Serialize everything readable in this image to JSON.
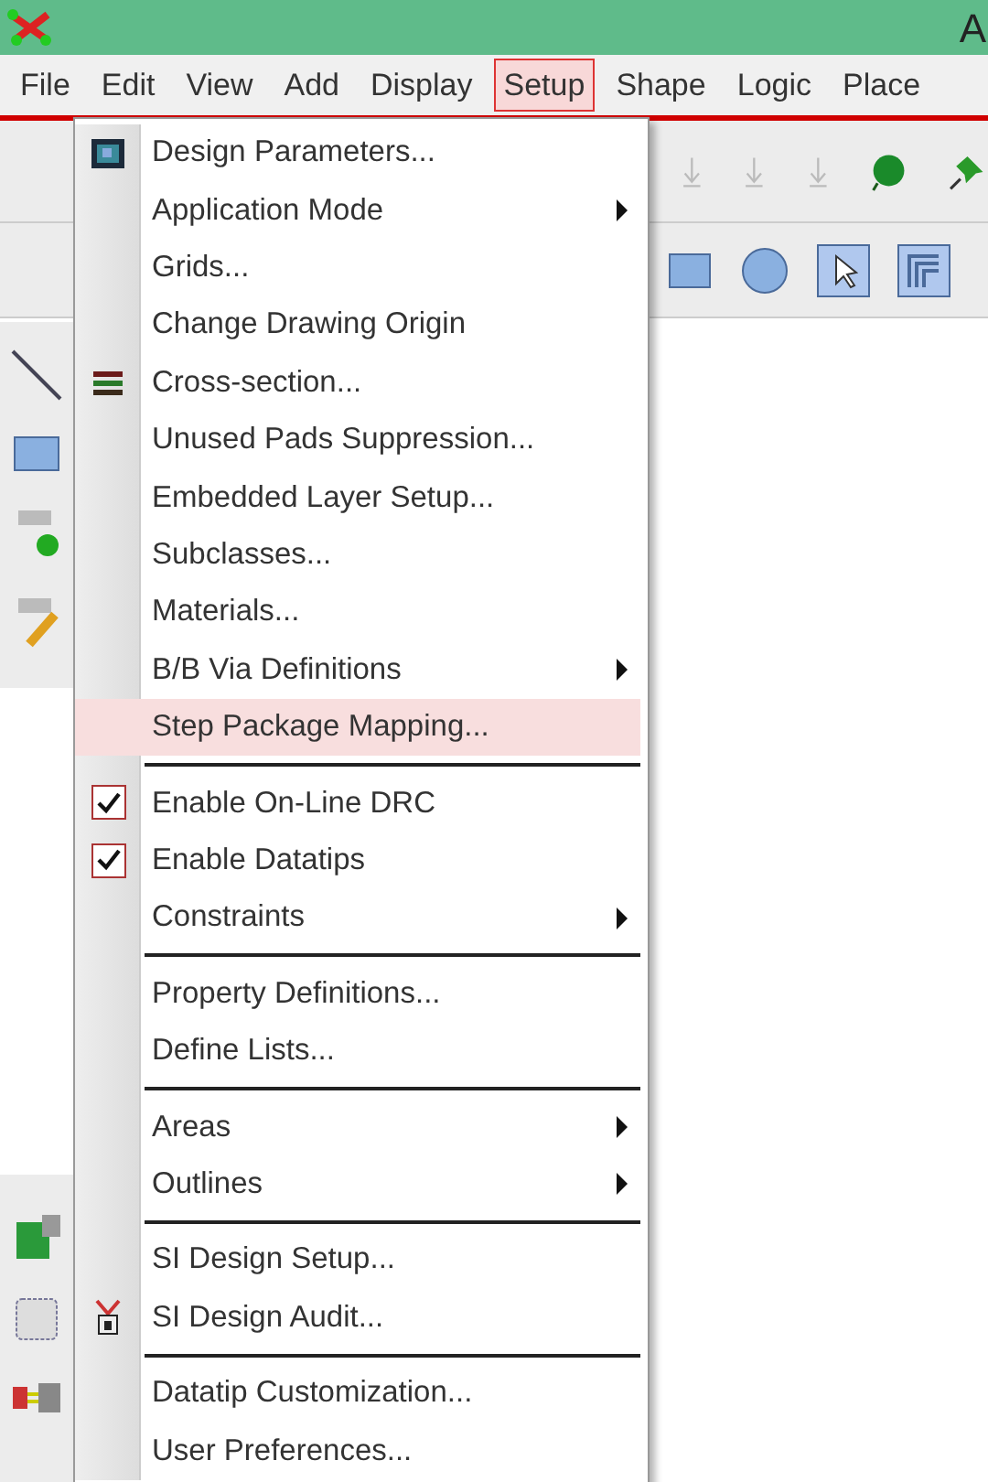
{
  "window": {
    "title": "A"
  },
  "menu_bar": [
    {
      "label": "File",
      "selected": false
    },
    {
      "label": "Edit",
      "selected": false
    },
    {
      "label": "View",
      "selected": false
    },
    {
      "label": "Add",
      "selected": false
    },
    {
      "label": "Display",
      "selected": false
    },
    {
      "label": "Setup",
      "selected": true
    },
    {
      "label": "Shape",
      "selected": false
    },
    {
      "label": "Logic",
      "selected": false
    },
    {
      "label": "Place",
      "selected": false
    }
  ],
  "menu": [
    {
      "kind": "command",
      "label": "Design Parameters...",
      "selected": false
    },
    {
      "kind": "submenu",
      "label": "Application Mode",
      "selected": false
    },
    {
      "kind": "command",
      "label": "Grids...",
      "selected": false
    },
    {
      "kind": "command",
      "label": "Change Drawing Origin",
      "selected": false
    },
    {
      "kind": "command",
      "label": "Cross-section...",
      "selected": false
    },
    {
      "kind": "command",
      "label": "Unused Pads Suppression...",
      "selected": false
    },
    {
      "kind": "command",
      "label": "Embedded Layer Setup...",
      "selected": false
    },
    {
      "kind": "command",
      "label": "Subclasses...",
      "selected": false
    },
    {
      "kind": "command",
      "label": "Materials...",
      "selected": false
    },
    {
      "kind": "submenu",
      "label": "B/B Via Definitions",
      "selected": false
    },
    {
      "kind": "command",
      "label": "Step Package Mapping...",
      "selected": true
    },
    {
      "kind": "separator"
    },
    {
      "kind": "check",
      "label": "Enable On-Line DRC",
      "checked": true,
      "selected": false
    },
    {
      "kind": "check",
      "label": "Enable Datatips",
      "checked": true,
      "selected": false
    },
    {
      "kind": "submenu",
      "label": "Constraints",
      "selected": false
    },
    {
      "kind": "separator"
    },
    {
      "kind": "command",
      "label": "Property Definitions...",
      "selected": false
    },
    {
      "kind": "command",
      "label": "Define Lists...",
      "selected": false
    },
    {
      "kind": "separator"
    },
    {
      "kind": "submenu",
      "label": "Areas",
      "selected": false
    },
    {
      "kind": "submenu",
      "label": "Outlines",
      "selected": false
    },
    {
      "kind": "separator"
    },
    {
      "kind": "command",
      "label": "SI Design Setup...",
      "selected": false
    },
    {
      "kind": "command",
      "label": "SI Design Audit...",
      "selected": false
    },
    {
      "kind": "separator"
    },
    {
      "kind": "command",
      "label": "Datatip Customization...",
      "selected": false
    },
    {
      "kind": "command",
      "label": "User Preferences...",
      "selected": false
    }
  ]
}
